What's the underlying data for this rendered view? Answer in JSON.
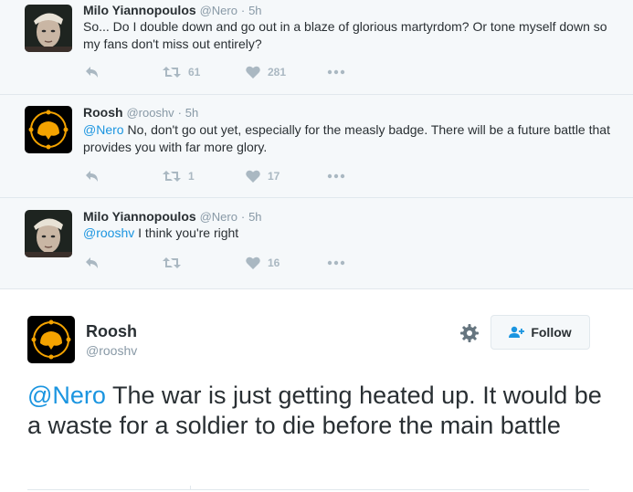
{
  "thread": [
    {
      "author_name": "Milo Yiannopoulos",
      "author_handle": "@Nero",
      "separator": "·",
      "time": "5h",
      "mention": "",
      "text": "So... Do I double down and go out in a blaze of glorious martyrdom? Or tone myself down so my fans don't miss out entirely?",
      "avatar": "milo-photo",
      "retweets": "61",
      "likes": "281"
    },
    {
      "author_name": "Roosh",
      "author_handle": "@rooshv",
      "separator": "·",
      "time": "5h",
      "mention": "@Nero",
      "text": " No, don't go out yet, especially for the measly badge. There will be a future battle that provides you with far more glory.",
      "avatar": "roosh-logo",
      "retweets": "1",
      "likes": "17"
    },
    {
      "author_name": "Milo Yiannopoulos",
      "author_handle": "@Nero",
      "separator": "·",
      "time": "5h",
      "mention": "@rooshv",
      "text": " I think you're right",
      "avatar": "milo-photo",
      "retweets": "",
      "likes": "16"
    }
  ],
  "main_tweet": {
    "author_name": "Roosh",
    "author_handle": "@rooshv",
    "follow_label": "Follow",
    "mention": "@Nero",
    "text": " The war is just getting heated up. It would be a waste for a soldier to die before the main battle"
  },
  "colors": {
    "link": "#1b95e0",
    "muted": "#8899a6",
    "icon": "#aab8c2",
    "thread_bg": "#f5f8fa",
    "logo_orange": "#f4a300"
  }
}
